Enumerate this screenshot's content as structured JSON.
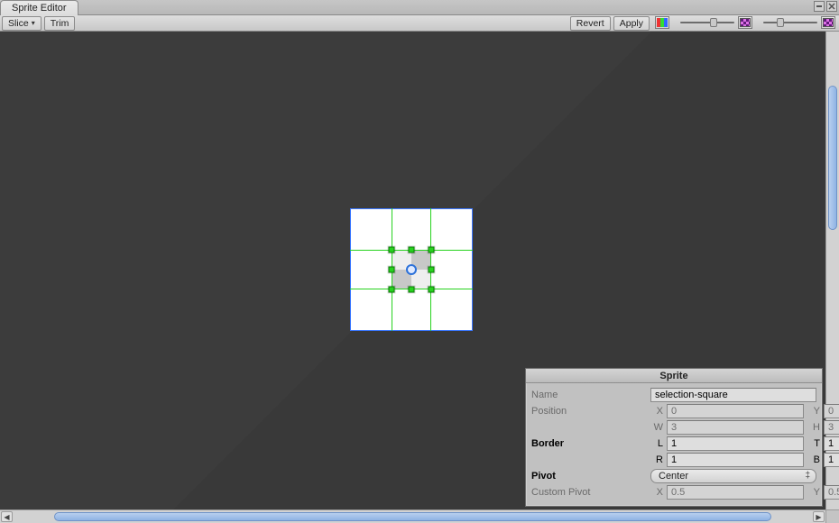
{
  "window": {
    "tab_title": "Sprite Editor"
  },
  "toolbar": {
    "slice_label": "Slice",
    "trim_label": "Trim",
    "revert_label": "Revert",
    "apply_label": "Apply"
  },
  "sprite_panel": {
    "title": "Sprite",
    "name_label": "Name",
    "name_value": "selection-square",
    "position_label": "Position",
    "pos_x": "0",
    "pos_y": "0",
    "pos_w": "3",
    "pos_h": "3",
    "border_label": "Border",
    "border_l": "1",
    "border_t": "1",
    "border_r": "1",
    "border_b": "1",
    "pivot_label": "Pivot",
    "pivot_value": "Center",
    "custom_pivot_label": "Custom Pivot",
    "custom_pivot_x": "0.5",
    "custom_pivot_y": "0.5",
    "labels": {
      "x": "X",
      "y": "Y",
      "w": "W",
      "h": "H",
      "l": "L",
      "t": "T",
      "r": "R",
      "b": "B"
    }
  }
}
